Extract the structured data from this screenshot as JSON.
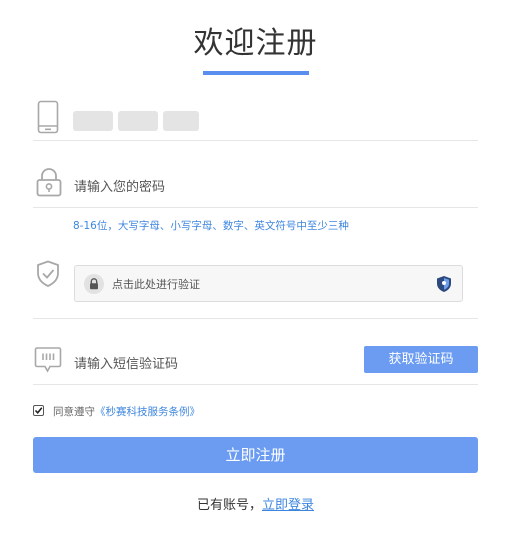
{
  "title": "欢迎注册",
  "phone_field": {
    "value": "",
    "icon": "phone-icon"
  },
  "password_field": {
    "placeholder": "请输入您的密码",
    "icon": "lock-icon"
  },
  "password_hint": "8-16位，大写字母、小写字母、数字、英文符号中至少三种",
  "verify_field": {
    "label": "点击此处进行验证",
    "icon": "shield-check-icon"
  },
  "sms_field": {
    "placeholder": "请输入短信验证码",
    "icon": "sms-icon",
    "button_label": "获取验证码"
  },
  "agreement": {
    "checked": true,
    "prefix": "同意遵守",
    "link_text": "《秒赛科技服务条例》"
  },
  "register_button": "立即注册",
  "login_prompt": {
    "text": "已有账号，",
    "link_text": "立即登录"
  },
  "colors": {
    "accent": "#6b9cf2",
    "link": "#3d86e0",
    "title_bar": "#5a8ff0"
  }
}
